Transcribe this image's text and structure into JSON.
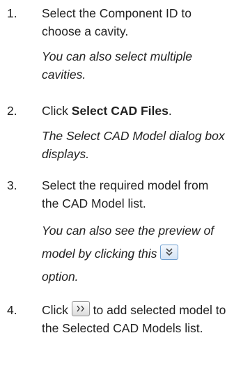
{
  "steps": [
    {
      "number": "1.",
      "instruction": "Select the Component ID to choose a cavity.",
      "note": "You can also select multiple cavities."
    },
    {
      "number": "2.",
      "instruction_prefix": "Click ",
      "instruction_bold": "Select CAD Files",
      "instruction_suffix": ".",
      "note": "The Select CAD Model dialog box displays."
    },
    {
      "number": "3.",
      "instruction": "Select the required model from the CAD Model list.",
      "note_prefix": "You can also see the preview of model by clicking this",
      "note_suffix": "option.",
      "icon": "chevron-double-down-icon"
    },
    {
      "number": "4.",
      "instruction_prefix": "Click",
      "instruction_suffix": "to add selected model to the Selected CAD Models list.",
      "icon": "double-right-arrow-icon"
    }
  ]
}
